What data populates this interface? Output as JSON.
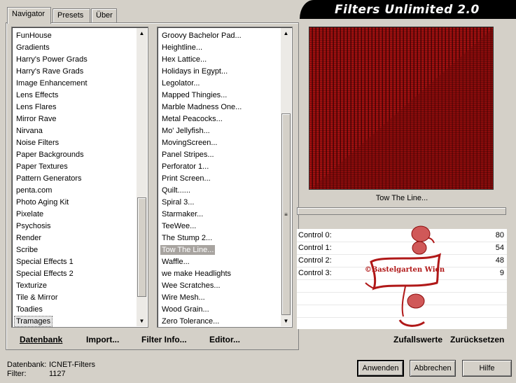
{
  "tabs": [
    {
      "label": "Navigator",
      "active": true
    },
    {
      "label": "Presets",
      "active": false
    },
    {
      "label": "Über",
      "active": false
    }
  ],
  "banner": {
    "title": "Filters Unlimited 2.0"
  },
  "categories": [
    "FunHouse",
    "Gradients",
    "Harry's Power Grads",
    "Harry's Rave Grads",
    "Image Enhancement",
    "Lens Effects",
    "Lens Flares",
    "Mirror Rave",
    "Nirvana",
    "Noise Filters",
    "Paper Backgrounds",
    "Paper Textures",
    "Pattern Generators",
    "penta.com",
    "Photo Aging Kit",
    "Pixelate",
    "Psychosis",
    "Render",
    "Scribe",
    "Special Effects 1",
    "Special Effects 2",
    "Texturize",
    "Tile & Mirror",
    "Toadies",
    "Tramages"
  ],
  "filters": [
    "Groovy Bachelor Pad...",
    "Heightline...",
    "Hex Lattice...",
    "Holidays in Egypt...",
    "Legolator...",
    "Mapped Thingies...",
    "Marble Madness One...",
    "Metal Peacocks...",
    "Mo' Jellyfish...",
    "MovingScreen...",
    "Panel Stripes...",
    "Perforator 1...",
    "Print Screen...",
    "Quilt......",
    "Spiral 3...",
    "Starmaker...",
    "TeeWee...",
    "The Stump 2...",
    "Tow The Line...",
    "Waffle...",
    "we make Headlights",
    "Wee Scratches...",
    "Wire Mesh...",
    "Wood Grain...",
    "Zero Tolerance..."
  ],
  "panel_buttons": {
    "datenbank": "Datenbank",
    "import": "Import...",
    "filter_info": "Filter Info...",
    "editor": "Editor..."
  },
  "selected_filter": "Tow The Line...",
  "controls": [
    {
      "label": "Control 0:",
      "value": "80"
    },
    {
      "label": "Control 1:",
      "value": "54"
    },
    {
      "label": "Control 2:",
      "value": "48"
    },
    {
      "label": "Control 3:",
      "value": "9"
    }
  ],
  "actions": {
    "random": "Zufallswerte",
    "reset": "Zurücksetzen"
  },
  "status": {
    "db_label": "Datenbank:",
    "db_value": "ICNET-Filters",
    "filter_label": "Filter:",
    "filter_value": "1127"
  },
  "buttons": {
    "apply": "Anwenden",
    "cancel": "Abbrechen",
    "help": "Hilfe"
  },
  "seal": {
    "text": "©Bastelgarten Wien"
  },
  "colors": {
    "preview_red": "#a00f0f",
    "preview_dark": "#5a0606",
    "seal_red": "#b01818"
  }
}
